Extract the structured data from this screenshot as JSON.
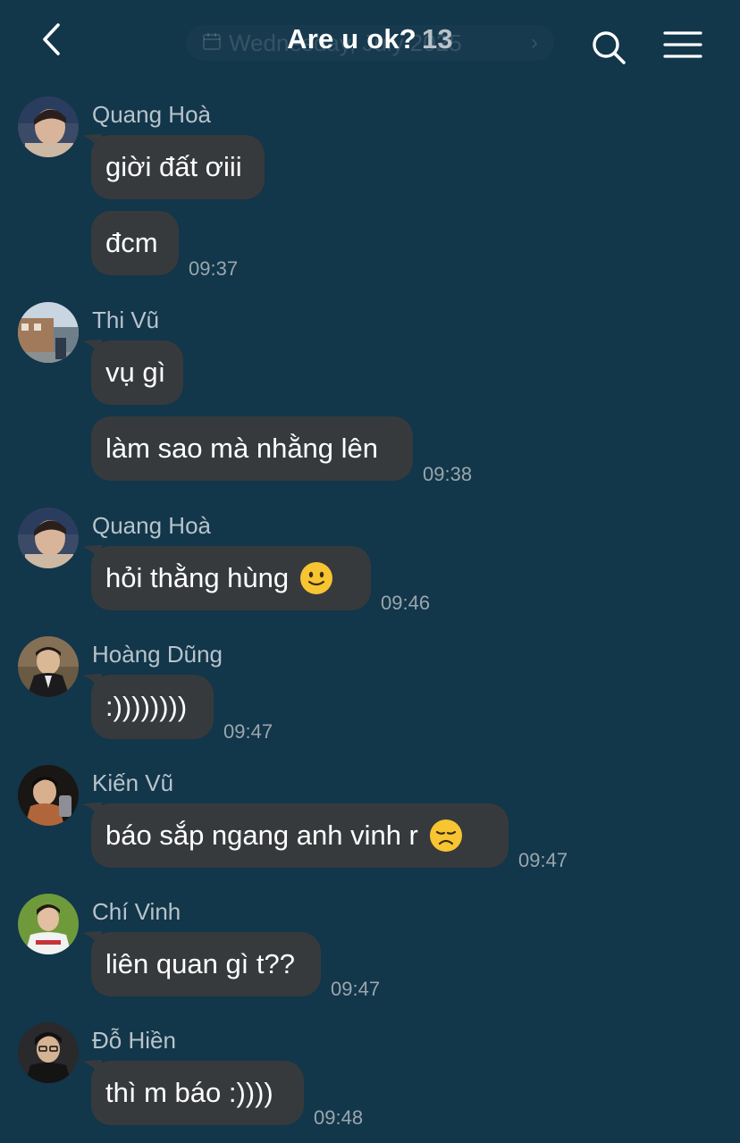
{
  "header": {
    "title": "Are u ok?",
    "member_count": "13",
    "date_pill": "Wednesday, July 2025",
    "back_icon": "chevron-left-icon",
    "search_icon": "search-icon",
    "menu_icon": "hamburger-menu-icon"
  },
  "colors": {
    "background": "#12364a",
    "bubble": "#373a3d",
    "time": "#9aa6ad",
    "sender": "#b8c3ca"
  },
  "groups": [
    {
      "sender": "Quang Hoà",
      "messages": [
        {
          "text": "giời đất ơiii"
        },
        {
          "text": "đcm",
          "time": "09:37"
        }
      ]
    },
    {
      "sender": "Thi Vũ",
      "messages": [
        {
          "text": "vụ gì"
        },
        {
          "text": "làm sao mà nhằng lên",
          "time": "09:38"
        }
      ]
    },
    {
      "sender": "Quang Hoà",
      "messages": [
        {
          "text": "hỏi thằng hùng",
          "emoji": "slightly-smiling-face",
          "time": "09:46"
        }
      ]
    },
    {
      "sender": "Hoàng Dũng",
      "messages": [
        {
          "text": ":))))))))",
          "time": "09:47"
        }
      ]
    },
    {
      "sender": "Kiến Vũ",
      "messages": [
        {
          "text": "báo sắp ngang anh vinh r",
          "emoji": "disappointed-face",
          "time": "09:47"
        }
      ]
    },
    {
      "sender": "Chí Vinh",
      "messages": [
        {
          "text": "liên quan gì t??",
          "time": "09:47"
        }
      ]
    },
    {
      "sender": "Đỗ Hiền",
      "messages": [
        {
          "text": "thì m báo :))))",
          "time": "09:48"
        }
      ]
    }
  ]
}
